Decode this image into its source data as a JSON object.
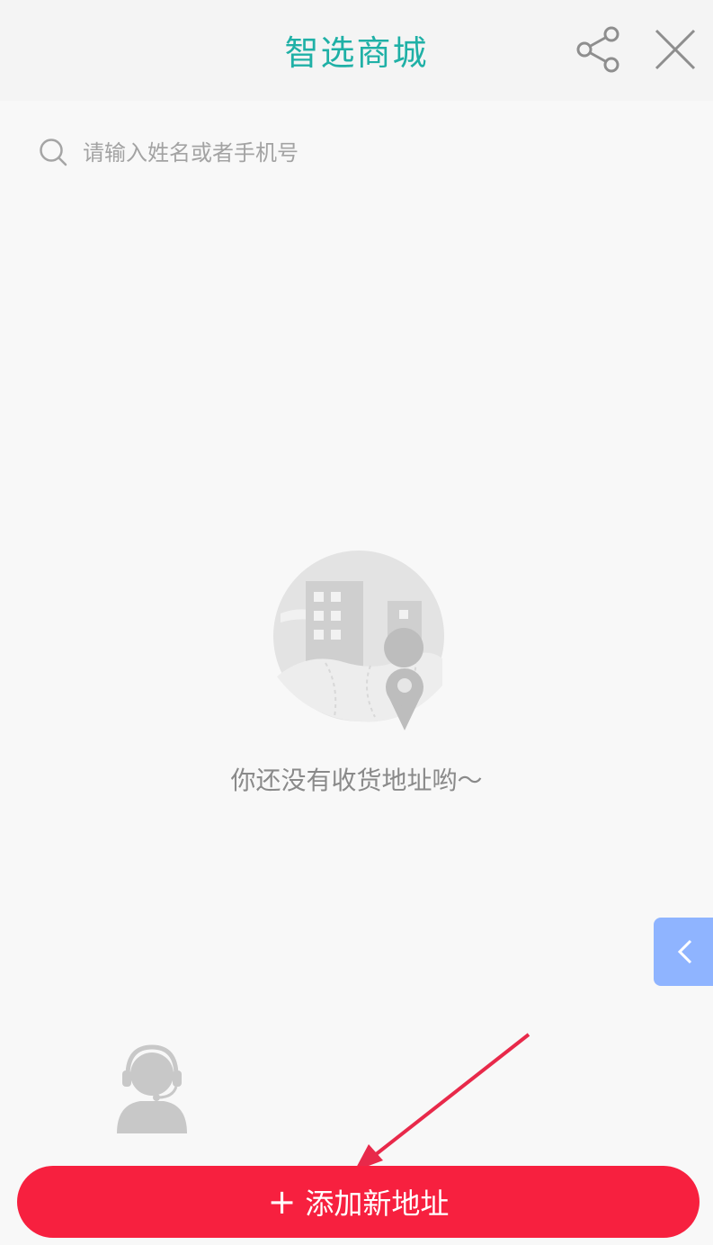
{
  "header": {
    "title": "智选商城",
    "share_icon": "share-icon",
    "close_icon": "close-icon"
  },
  "search": {
    "placeholder": "请输入姓名或者手机号",
    "value": "",
    "icon": "search-icon"
  },
  "empty_state": {
    "illustration": "city-building-location-illustration",
    "message": "你还没有收货地址哟～"
  },
  "side_tab": {
    "icon": "chevron-left-icon"
  },
  "customer_service": {
    "icon": "customer-service-avatar-icon"
  },
  "bottom": {
    "add_button_icon": "+",
    "add_button_label": "添加新地址"
  },
  "colors": {
    "title": "#1fb0a6",
    "primary_button": "#f7203f",
    "side_tab": "#8fb4ff",
    "annotation_arrow": "#e8294a"
  }
}
